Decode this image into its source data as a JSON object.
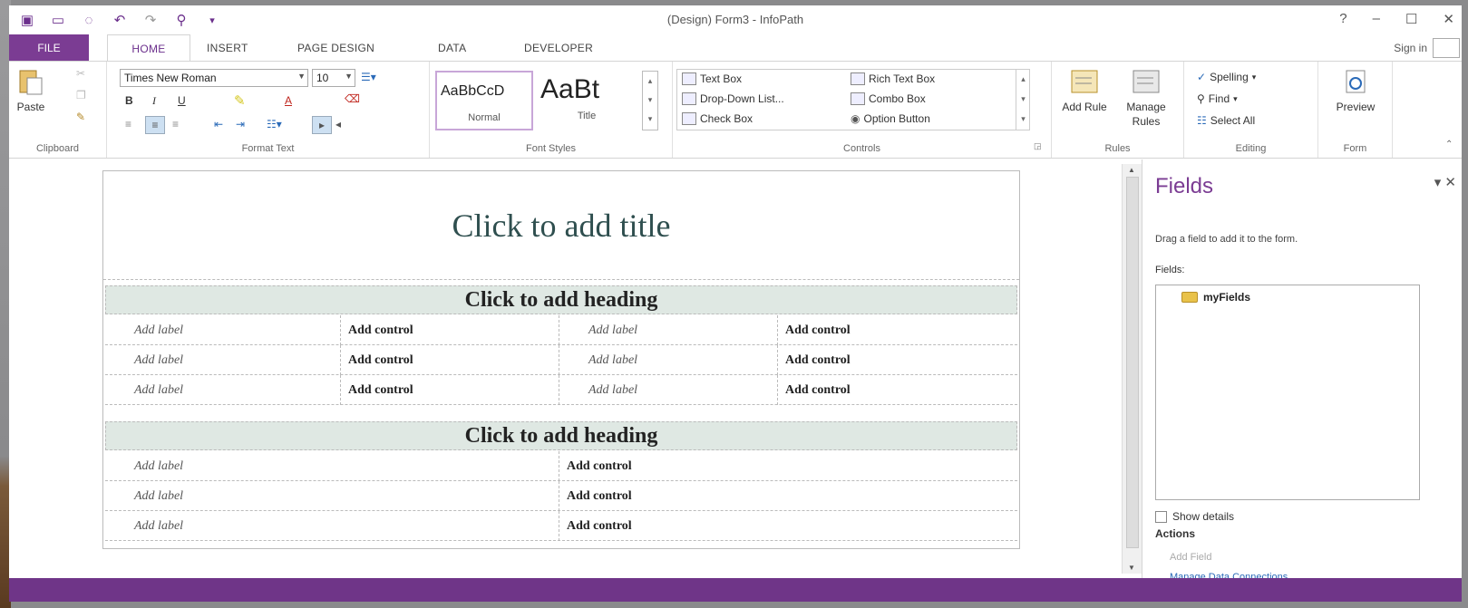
{
  "window": {
    "title": "(Design) Form3 - InfoPath",
    "help": "?",
    "minimize": "–",
    "maximize": "☐",
    "close": "✕"
  },
  "qat": {
    "icons": [
      "infopath-logo-icon",
      "save-icon",
      "preview-icon",
      "undo-icon",
      "redo-icon",
      "format-painter-icon",
      "customize-icon"
    ]
  },
  "tabs": {
    "file": "FILE",
    "home": "HOME",
    "insert": "INSERT",
    "page_design": "PAGE DESIGN",
    "data": "DATA",
    "developer": "DEVELOPER",
    "sign_in": "Sign in"
  },
  "ribbon": {
    "clipboard": {
      "paste": "Paste",
      "group": "Clipboard"
    },
    "format_text": {
      "font": "Times New Roman",
      "size": "10",
      "bold": "B",
      "italic": "I",
      "underline": "U",
      "font_color": "A",
      "group": "Format Text"
    },
    "font_styles": {
      "normal_sample": "AaBbCcD",
      "normal_label": "Normal",
      "title_sample": "AaBt",
      "title_label": "Title",
      "group": "Font Styles"
    },
    "controls": {
      "text_box": "Text Box",
      "dropdown": "Drop-Down List...",
      "check_box": "Check Box",
      "rich_text_box": "Rich Text Box",
      "combo_box": "Combo Box",
      "option_button": "Option Button",
      "group": "Controls"
    },
    "rules": {
      "add_rule": "Add Rule",
      "manage_rules": "Manage Rules",
      "group": "Rules"
    },
    "editing": {
      "spelling": "Spelling",
      "find": "Find",
      "select_all": "Select All",
      "group": "Editing"
    },
    "form": {
      "preview": "Preview",
      "group": "Form"
    }
  },
  "form": {
    "title": "Click to add title",
    "section1": {
      "heading": "Click to add heading",
      "rows": [
        [
          "Add label",
          "Add control",
          "Add label",
          "Add control"
        ],
        [
          "Add label",
          "Add control",
          "Add label",
          "Add control"
        ],
        [
          "Add label",
          "Add control",
          "Add label",
          "Add control"
        ]
      ]
    },
    "section2": {
      "heading": "Click to add heading",
      "rows": [
        [
          "Add label",
          "Add control"
        ],
        [
          "Add label",
          "Add control"
        ],
        [
          "Add label",
          "Add control"
        ]
      ]
    }
  },
  "fields_pane": {
    "title": "Fields",
    "description": "Drag a field to add it to the form.",
    "fields_label": "Fields:",
    "root_node": "myFields",
    "show_details": "Show details",
    "actions": "Actions",
    "add_field": "Add Field",
    "manage_connections": "Manage Data Connections..."
  },
  "colors": {
    "accent": "#7b3c93",
    "status_bar": "#6f3588",
    "heading_bg": "#dfe8e3"
  }
}
